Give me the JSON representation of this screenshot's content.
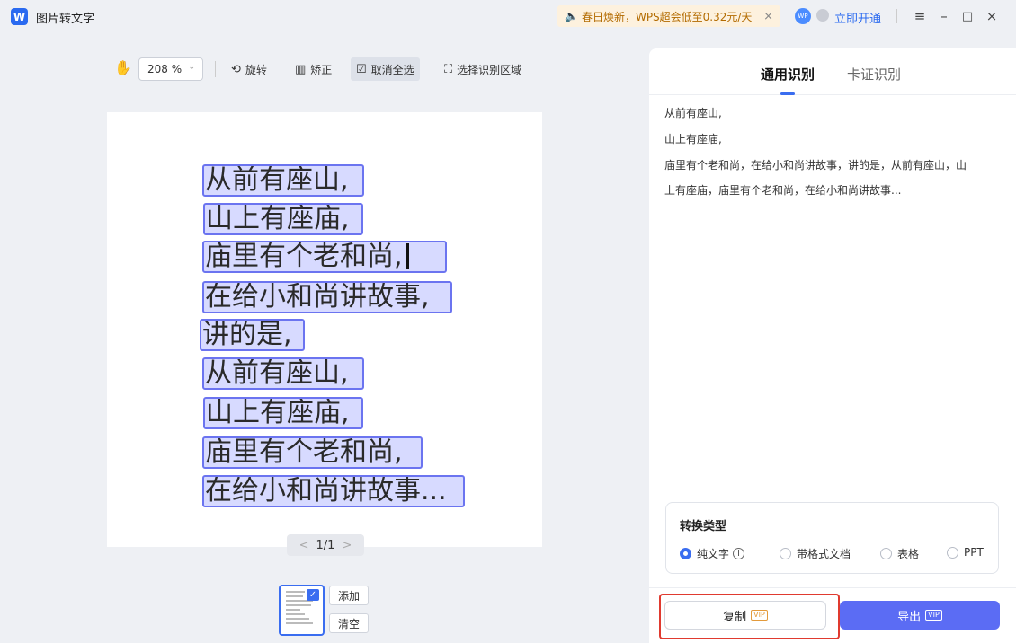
{
  "app": {
    "logo": "W",
    "title": "图片转文字"
  },
  "promo": {
    "text": "春日焕新，WPS超会低至0.32元/天",
    "close": "×"
  },
  "account": {
    "badge": "WP",
    "activate": "立即开通"
  },
  "window": {
    "menu": "≡",
    "minimize": "–",
    "maximize": "□",
    "close": "×"
  },
  "toolbar": {
    "hand": "✋",
    "zoom": "208 %",
    "rotate": "旋转",
    "deskew": "矫正",
    "deselect_all": "取消全选",
    "select_region": "选择识别区域"
  },
  "ocr_lines": [
    "从前有座山,",
    "山上有座庙,",
    "庙里有个老和尚,",
    "在给小和尚讲故事,",
    "讲的是,",
    "从前有座山,",
    "山上有座庙,",
    "庙里有个老和尚,",
    "在给小和尚讲故事..."
  ],
  "pager": {
    "prev": "<",
    "label": "1/1",
    "next": ">"
  },
  "thumbs": {
    "add": "添加",
    "clear": "清空"
  },
  "panel": {
    "tab_general": "通用识别",
    "tab_card": "卡证识别",
    "result_lines": [
      "从前有座山,",
      "山上有座庙,",
      "庙里有个老和尚，在给小和尚讲故事，讲的是，从前有座山，山",
      "上有座庙，庙里有个老和尚，在给小和尚讲故事..."
    ]
  },
  "convert": {
    "title": "转换类型",
    "options": [
      "纯文字",
      "带格式文档",
      "表格",
      "PPT"
    ],
    "selected": "纯文字"
  },
  "actions": {
    "copy": "复制",
    "export": "导出",
    "vip": "VIP"
  }
}
